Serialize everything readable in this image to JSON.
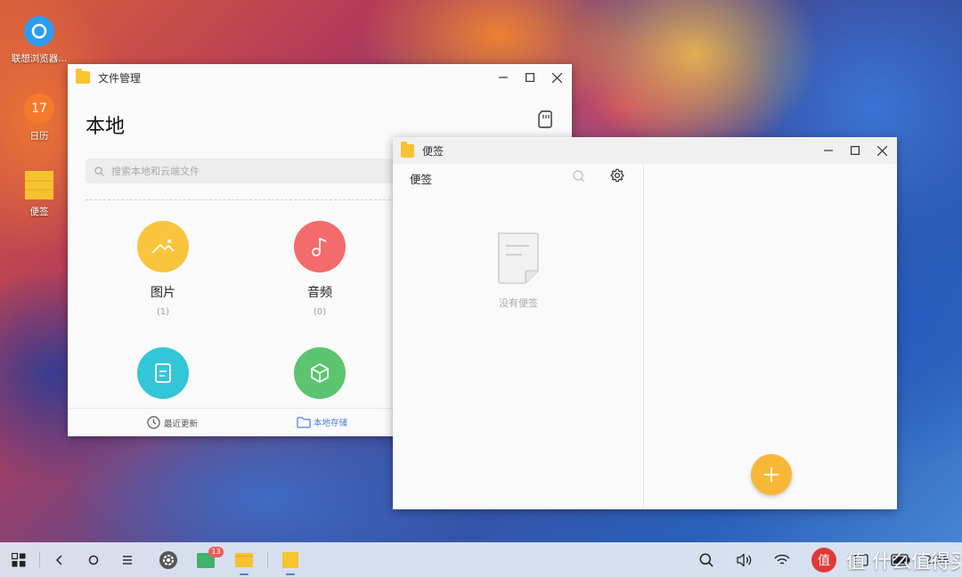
{
  "desktop": {
    "icons": [
      {
        "label": "联想浏览器..."
      },
      {
        "label": "日历",
        "day": "17"
      },
      {
        "label": "便签"
      }
    ]
  },
  "file_manager": {
    "title": "文件管理",
    "heading": "本地",
    "search_placeholder": "搜索本地和云端文件",
    "categories": [
      {
        "name": "图片",
        "count": "(1)",
        "icon": "image-icon",
        "color": "#f9c53e"
      },
      {
        "name": "音频",
        "count": "(0)",
        "icon": "music-icon",
        "color": "#f36b6b"
      },
      {
        "name": "",
        "count": "",
        "icon": "document-icon",
        "color": "#33c6d6"
      },
      {
        "name": "",
        "count": "",
        "icon": "package-icon",
        "color": "#5cc46f"
      }
    ],
    "nav": {
      "recent": "最近更新",
      "local": "本地存储"
    }
  },
  "notes": {
    "title": "便签",
    "pane_title": "便签",
    "empty_text": "没有便签"
  },
  "taskbar": {
    "mail_badge": "13",
    "clock": "2:38",
    "watermark": "值 什么值得买"
  },
  "colors": {
    "accent_yellow": "#f7c32e",
    "fab": "#f7b838",
    "link_blue": "#4a7de0"
  }
}
